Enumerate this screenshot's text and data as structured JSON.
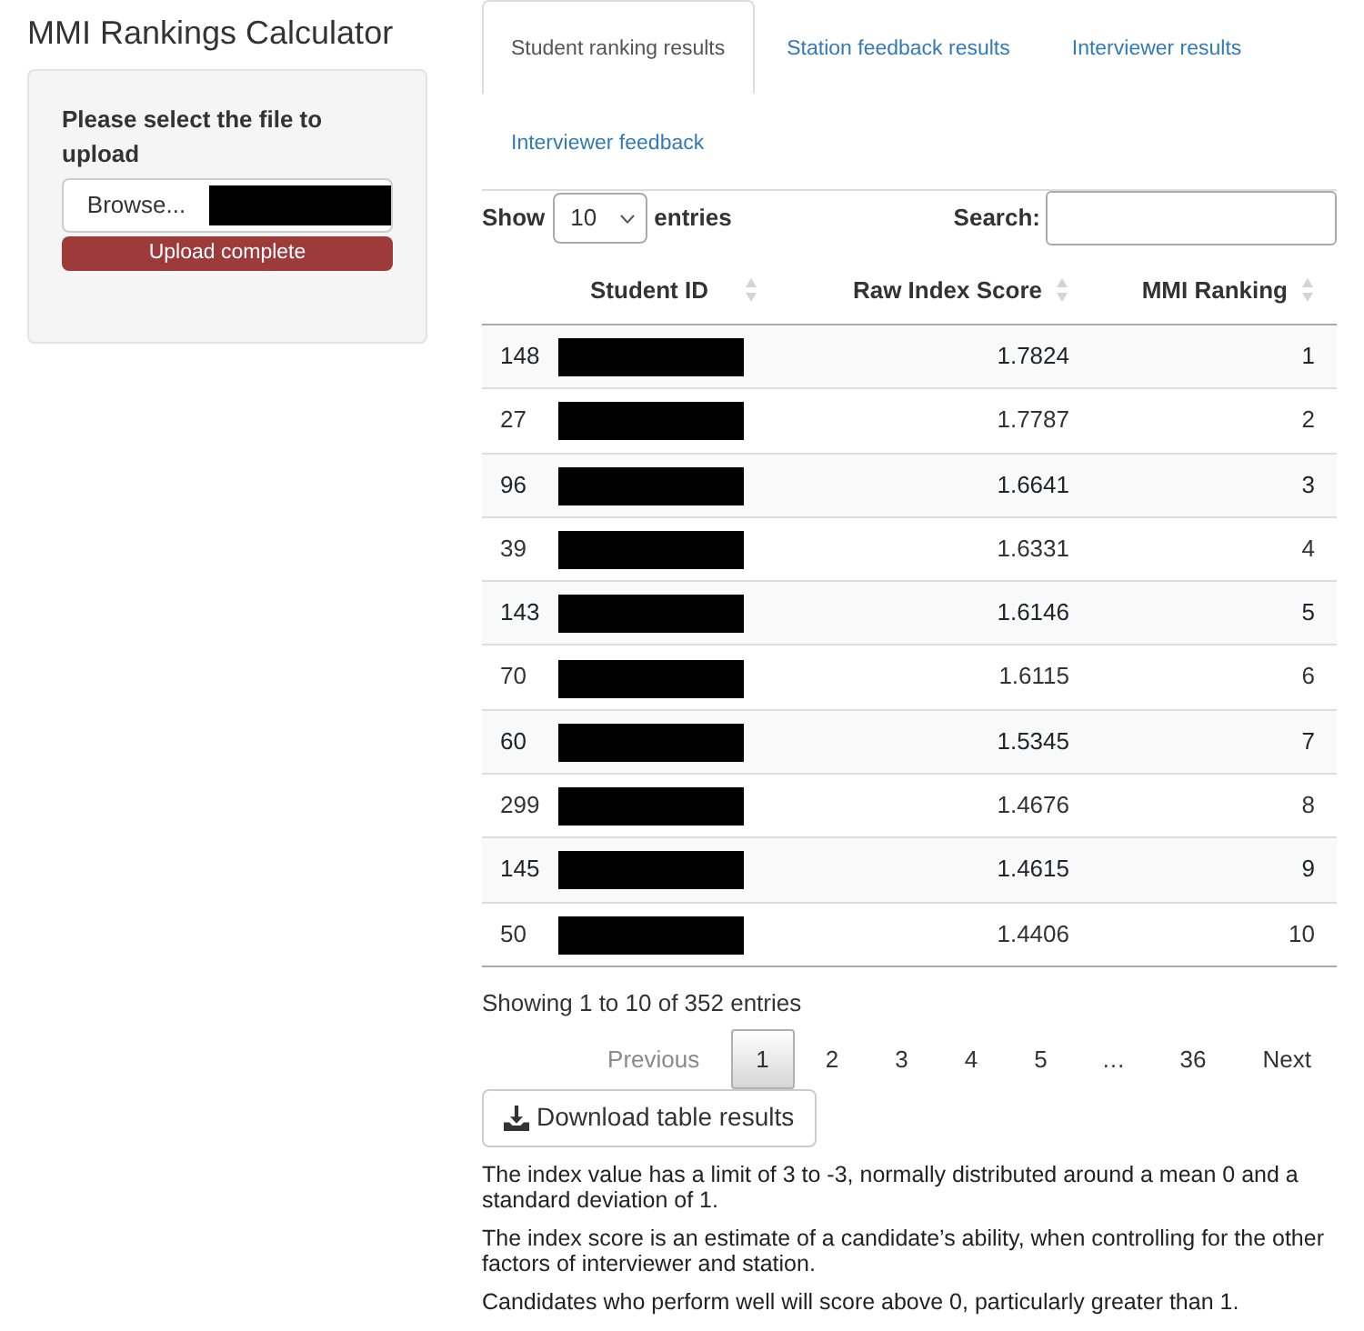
{
  "app": {
    "title": "MMI Rankings Calculator"
  },
  "upload_panel": {
    "label": "Please select the file to upload",
    "browse_button": "Browse...",
    "file_name_redacted": true,
    "progress": {
      "level": 1,
      "label": "Upload complete"
    }
  },
  "tabs": [
    {
      "label": "Student ranking results",
      "selected": true
    },
    {
      "label": "Station feedback results",
      "selected": false
    },
    {
      "label": "Interviewer results",
      "selected": false
    },
    {
      "label": "Interviewer feedback",
      "selected": false
    }
  ],
  "table_controls": {
    "show_label": "Show",
    "page_length": "10",
    "entries_label": "entries",
    "search_label": "Search:"
  },
  "table": {
    "columns": [
      {
        "label": "Student ID",
        "sortable": true
      },
      {
        "label": "Raw Index Score",
        "sortable": true
      },
      {
        "label": "MMI Ranking",
        "sortable": true
      }
    ],
    "rows": [
      {
        "column_1": "148",
        "student_id_redacted": true,
        "raw_index_score": "1.7824",
        "mmi_ranking": "1"
      },
      {
        "column_1": "27",
        "student_id_redacted": true,
        "raw_index_score": "1.7787",
        "mmi_ranking": "2"
      },
      {
        "column_1": "96",
        "student_id_redacted": true,
        "raw_index_score": "1.6641",
        "mmi_ranking": "3"
      },
      {
        "column_1": "39",
        "student_id_redacted": true,
        "raw_index_score": "1.6331",
        "mmi_ranking": "4"
      },
      {
        "column_1": "143",
        "student_id_redacted": true,
        "raw_index_score": "1.6146",
        "mmi_ranking": "5"
      },
      {
        "column_1": "70",
        "student_id_redacted": true,
        "raw_index_score": "1.6115",
        "mmi_ranking": "6"
      },
      {
        "column_1": "60",
        "student_id_redacted": true,
        "raw_index_score": "1.5345",
        "mmi_ranking": "7"
      },
      {
        "column_1": "299",
        "student_id_redacted": true,
        "raw_index_score": "1.4676",
        "mmi_ranking": "8"
      },
      {
        "column_1": "145",
        "student_id_redacted": true,
        "raw_index_score": "1.4615",
        "mmi_ranking": "9"
      },
      {
        "column_1": "50",
        "student_id_redacted": true,
        "raw_index_score": "1.4406",
        "mmi_ranking": "10"
      }
    ]
  },
  "table_info": "Showing 1 to 10 of 352 entries",
  "pagination": [
    {
      "kind": "previous",
      "label": "Previous",
      "disabled": true
    },
    {
      "kind": "page",
      "label": "1",
      "selected": true
    },
    {
      "kind": "page",
      "label": "2",
      "selected": false
    },
    {
      "kind": "page",
      "label": "3",
      "selected": false
    },
    {
      "kind": "page",
      "label": "4",
      "selected": false
    },
    {
      "kind": "page",
      "label": "5",
      "selected": false
    },
    {
      "kind": "ellipsis",
      "label": "…"
    },
    {
      "kind": "page",
      "label": "36",
      "selected": false
    },
    {
      "kind": "next",
      "label": "Next",
      "disabled": false
    }
  ],
  "download_button": "Download table results",
  "notes": [
    "The index value has a limit of 3 to -3, normally distributed around a mean 0 and a standard deviation of 1.",
    "The index score is an estimate of a candidate’s ability, when controlling for the other factors of interviewer and station.",
    "Candidates who perform well will score above 0, particularly greater than 1."
  ]
}
